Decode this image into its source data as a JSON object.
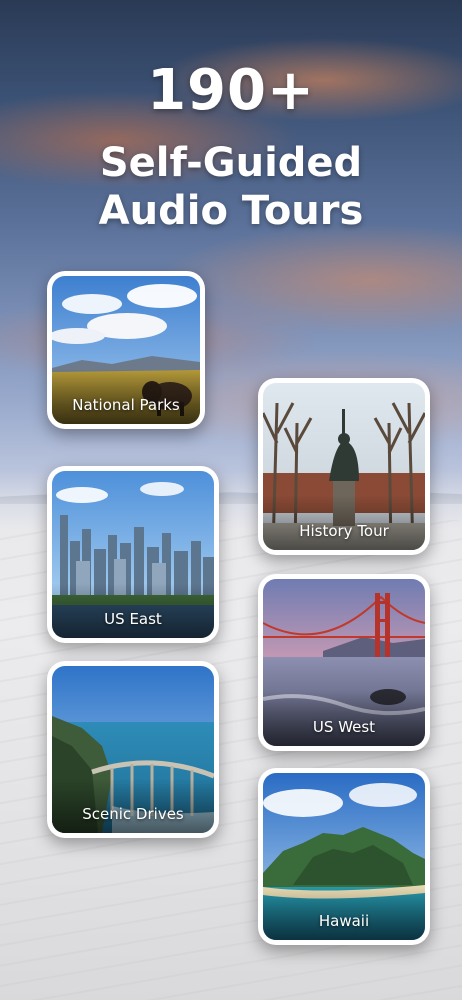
{
  "headline": {
    "count": "190+",
    "line1": "Self-Guided",
    "line2": "Audio Tours"
  },
  "tours": [
    {
      "label": "National Parks",
      "image": "bison-prairie-photo"
    },
    {
      "label": "History Tour",
      "image": "statue-tree-avenue-photo"
    },
    {
      "label": "US East",
      "image": "city-skyline-photo"
    },
    {
      "label": "US West",
      "image": "golden-gate-bridge-photo"
    },
    {
      "label": "Scenic Drives",
      "image": "coastal-bridge-photo"
    },
    {
      "label": "Hawaii",
      "image": "tropical-island-photo"
    }
  ]
}
